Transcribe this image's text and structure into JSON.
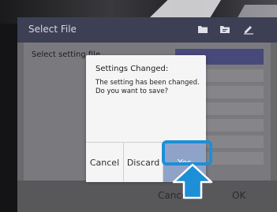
{
  "window": {
    "title": "Select File"
  },
  "toolbar": {
    "icons": [
      "folder-icon",
      "folder-copy-icon",
      "edit-icon"
    ]
  },
  "main": {
    "setting_label": "Select setting file"
  },
  "bottom": {
    "cancel_label": "Cancel",
    "ok_label": "OK"
  },
  "dialog": {
    "title": "Settings Changed:",
    "message_line1": "The setting has been changed.",
    "message_line2": "Do you want to save?",
    "buttons": {
      "cancel": "Cancel",
      "discard": "Discard",
      "yes": "Yes"
    },
    "selected_button": "Yes"
  },
  "colors": {
    "accent": "#1d8fd6",
    "titlebar": "#3d3f55",
    "selected_button": "#8fa3c9"
  }
}
